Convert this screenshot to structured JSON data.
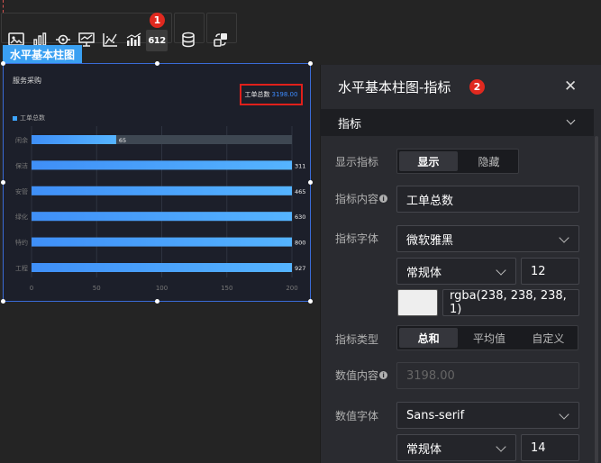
{
  "toolbar": {
    "kpi_icon_text": "612",
    "callout_1": "1"
  },
  "widget": {
    "tag": "水平基本柱图",
    "title": "服务采购",
    "kpi_label": "工单总数",
    "kpi_value": "3198.00",
    "legend": "工单总数"
  },
  "chart_data": {
    "type": "bar",
    "orientation": "horizontal",
    "title": "服务采购",
    "categories": [
      "闲余",
      "保洁",
      "安管",
      "绿化",
      "特约",
      "工程"
    ],
    "series": [
      {
        "name": "工单总数",
        "values": [
          65,
          311,
          465,
          630,
          800,
          927
        ]
      }
    ],
    "value_labels": [
      "65",
      "311",
      "465",
      "630",
      "800",
      "927"
    ],
    "x_ticks": [
      "0",
      "50",
      "100",
      "150",
      "200"
    ],
    "xlim": [
      0,
      200
    ],
    "colors": {
      "bar_start": "#3f8ff7",
      "bar_end": "#55b4ff",
      "track": "#3e4752"
    },
    "grid": true,
    "legend_position": "top-left"
  },
  "panel": {
    "title": "水平基本柱图-指标",
    "callout_2": "2",
    "section": "指标",
    "fields": {
      "show_label": "显示指标",
      "show_on": "显示",
      "show_off": "隐藏",
      "content_label": "指标内容",
      "content_value": "工单总数",
      "font_label": "指标字体",
      "font_family": "微软雅黑",
      "font_weight": "常规体",
      "font_size": "12",
      "font_color": "rgba(238, 238, 238, 1)",
      "type_label": "指标类型",
      "type_sum": "总和",
      "type_avg": "平均值",
      "type_custom": "自定义",
      "value_content_label": "数值内容",
      "value_content": "3198.00",
      "value_font_label": "数值字体",
      "value_font_family": "Sans-serif",
      "value_font_weight": "常规体",
      "value_font_size": "14"
    }
  },
  "colors": {
    "accent": "#3aa0f2",
    "danger": "#e0291f",
    "swatch": "#eeeeee"
  }
}
